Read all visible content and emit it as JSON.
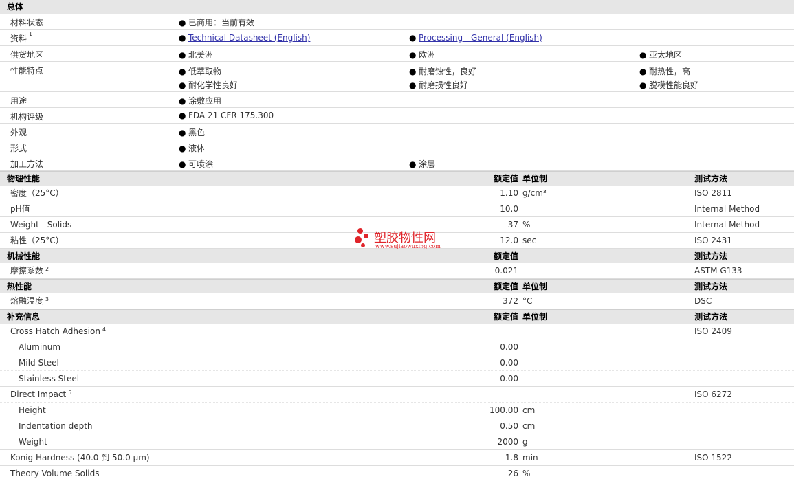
{
  "general": {
    "title": "总体",
    "rows": [
      {
        "label": "材料状态",
        "sup": "",
        "cells": [
          "已商用：当前有效"
        ]
      },
      {
        "label": "资料",
        "sup": "1",
        "links": [
          "Technical Datasheet (English)",
          "Processing - General (English)"
        ]
      },
      {
        "label": "供货地区",
        "sup": "",
        "cells": [
          "北美洲",
          "欧洲",
          "亚太地区"
        ]
      },
      {
        "label": "性能特点",
        "sup": "",
        "cells": [
          "低萃取物",
          "耐磨蚀性，良好",
          "耐热性，高",
          "耐化学性良好",
          "耐磨损性良好",
          "脱模性能良好"
        ]
      },
      {
        "label": "用途",
        "sup": "",
        "cells": [
          "涂敷应用"
        ]
      },
      {
        "label": "机构评级",
        "sup": "",
        "cells": [
          "FDA 21 CFR 175.300"
        ]
      },
      {
        "label": "外观",
        "sup": "",
        "cells": [
          "黑色"
        ]
      },
      {
        "label": "形式",
        "sup": "",
        "cells": [
          "液体"
        ]
      },
      {
        "label": "加工方法",
        "sup": "",
        "cells": [
          "可喷涂",
          "涂层"
        ]
      }
    ]
  },
  "columns": {
    "nominal": "额定值",
    "unit": "单位制",
    "test": "测试方法"
  },
  "physical": {
    "title": "物理性能",
    "rows": [
      {
        "label": "密度（25°C）",
        "value": "1.10",
        "unit": "g/cm³",
        "test": "ISO 2811"
      },
      {
        "label": "pH值",
        "value": "10.0",
        "unit": "",
        "test": "Internal Method"
      },
      {
        "label": "Weight - Solids",
        "value": "37",
        "unit": "%",
        "test": "Internal Method"
      },
      {
        "label": "粘性（25°C）",
        "value": "12.0",
        "unit": "sec",
        "test": "ISO 2431"
      }
    ]
  },
  "mechanical": {
    "title": "机械性能",
    "rows": [
      {
        "label": "摩擦系数",
        "sup": "2",
        "value": "0.021",
        "unit": "",
        "test": "ASTM G133"
      }
    ]
  },
  "thermal": {
    "title": "热性能",
    "rows": [
      {
        "label": "熔融温度",
        "sup": "3",
        "value": "372",
        "unit": "°C",
        "test": "DSC"
      }
    ]
  },
  "supplementary": {
    "title": "补充信息",
    "cross_hatch": {
      "label": "Cross Hatch Adhesion",
      "sup": "4",
      "test": "ISO 2409",
      "subs": [
        {
          "label": "Aluminum",
          "value": "0.00"
        },
        {
          "label": "Mild Steel",
          "value": "0.00"
        },
        {
          "label": "Stainless Steel",
          "value": "0.00"
        }
      ]
    },
    "direct_impact": {
      "label": "Direct Impact",
      "sup": "5",
      "test": "ISO 6272",
      "subs": [
        {
          "label": "Height",
          "value": "100.00",
          "unit": "cm"
        },
        {
          "label": "Indentation depth",
          "value": "0.50",
          "unit": "cm"
        },
        {
          "label": "Weight",
          "value": "2000",
          "unit": "g"
        }
      ]
    },
    "konig": {
      "label": "Konig Hardness (40.0 到  50.0 µm)",
      "value": "1.8",
      "unit": "min",
      "test": "ISO 1522"
    },
    "theory": {
      "label": "Theory Volume Solids",
      "value": "26",
      "unit": "%"
    }
  },
  "watermark": {
    "name": "塑胶物性网",
    "url": "www.sujiaowuxing.com",
    "color": "#e0242a"
  },
  "colors": {
    "header_bg": "#e6e6e6",
    "link": "#3333aa"
  }
}
